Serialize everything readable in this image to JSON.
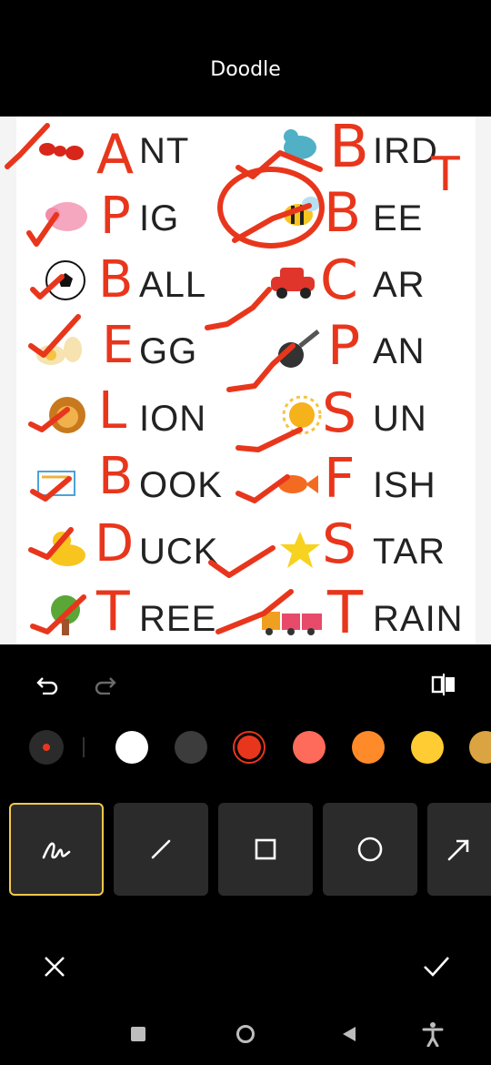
{
  "title": "Doodle",
  "worksheet": {
    "words": [
      "NT",
      "IG",
      "ALL",
      "GG",
      "ION",
      "OOK",
      "UCK",
      "REE",
      "IRD",
      "EE",
      "AR",
      "AN",
      "UN",
      "ISH",
      "TAR",
      "RAIN"
    ],
    "handwritten": {
      "letters": [
        "A",
        "P",
        "B",
        "E",
        "L",
        "B",
        "D",
        "T",
        "B",
        "B",
        "C",
        "P",
        "S",
        "F",
        "S",
        "T"
      ],
      "note": "T"
    },
    "pictures": [
      "ant",
      "pig",
      "ball",
      "egg",
      "lion",
      "book",
      "duck",
      "tree",
      "bird",
      "bee",
      "car",
      "pan",
      "sun",
      "fish",
      "star",
      "train"
    ]
  },
  "toolbar": {
    "undo_icon": "undo-icon",
    "redo_icon": "redo-icon",
    "compare_icon": "compare-icon"
  },
  "colors": {
    "selected_brush": "#e8361c",
    "swatches": [
      "#ffffff",
      "#3c3c3c",
      "#e8361c",
      "#ff6b5a",
      "#ff8a2a",
      "#ffcc33",
      "#d9a441"
    ],
    "active_border": "#f2c94c"
  },
  "tools": [
    {
      "name": "freehand",
      "icon": "scribble-icon",
      "active": true
    },
    {
      "name": "line",
      "icon": "line-icon",
      "active": false
    },
    {
      "name": "rectangle",
      "icon": "square-icon",
      "active": false
    },
    {
      "name": "circle",
      "icon": "circle-icon",
      "active": false
    },
    {
      "name": "arrow",
      "icon": "arrow-icon",
      "active": false
    }
  ],
  "actions": {
    "cancel_icon": "close-icon",
    "confirm_icon": "check-icon"
  },
  "navbar": [
    "recents-icon",
    "home-icon",
    "back-icon",
    "accessibility-icon"
  ]
}
